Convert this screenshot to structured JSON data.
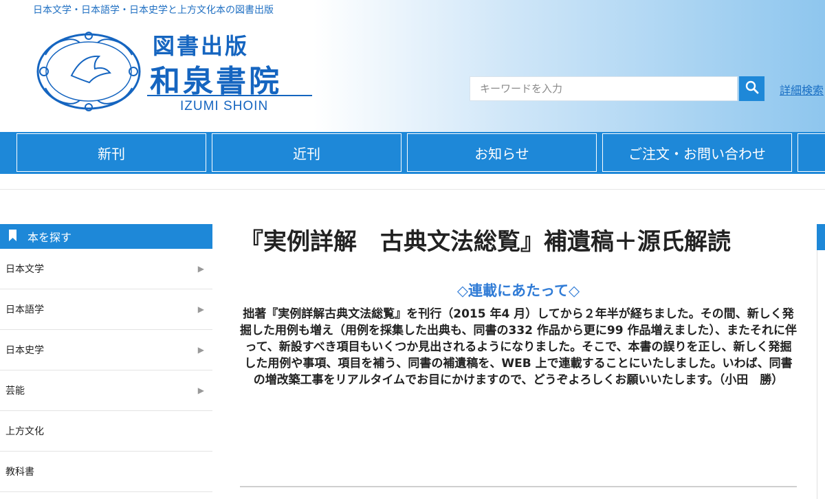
{
  "header": {
    "tagline": "日本文学・日本語学・日本史学と上方文化本の図書出版",
    "logo_line1": "図書出版",
    "logo_line2": "和泉書院",
    "logo_en": "IZUMI SHOIN",
    "logo_icon": "circle-of-hands-dove-logo"
  },
  "search": {
    "placeholder": "キーワードを入力",
    "button_icon": "search-icon",
    "advanced_link": "詳細検索"
  },
  "nav": {
    "items": [
      {
        "label": "新刊"
      },
      {
        "label": "近刊"
      },
      {
        "label": "お知らせ"
      },
      {
        "label": "ご注文・お問い合わせ"
      }
    ]
  },
  "sidebar": {
    "heading": "本を探す",
    "heading_icon": "bookmark-icon",
    "items": [
      {
        "label": "日本文学",
        "arrow": "▶"
      },
      {
        "label": "日本語学",
        "arrow": "▶"
      },
      {
        "label": "日本史学",
        "arrow": "▶"
      },
      {
        "label": "芸能",
        "arrow": "▶"
      },
      {
        "label": "上方文化",
        "arrow": ""
      },
      {
        "label": "教科書",
        "arrow": ""
      }
    ]
  },
  "article": {
    "title": "『実例詳解　古典文法総覧』補遺稿＋源氏解読",
    "subheading": "◇連載にあたって◇",
    "body": "拙著『実例詳解古典文法総覧』を刊行（2015 年4 月）してから２年半が経ちました。その間、新しく発掘した用例も増え（用例を採集した出典も、同書の332 作品から更に99 作品増えました）、またそれに伴って、新設すべき項目もいくつか見出されるようになりました。そこで、本書の誤りを正し、新しく発掘した用例や事項、項目を補う、同書の補遺稿を、WEB 上で連載することにいたしました。いわば、同書の増改築工事をリアルタイムでお目にかけますので、どうぞよろしくお願いいたします。（小田　勝）"
  },
  "colors": {
    "brand_blue": "#1565c0",
    "nav_blue": "#1e88d8",
    "accent_text": "#2f7bd6"
  }
}
